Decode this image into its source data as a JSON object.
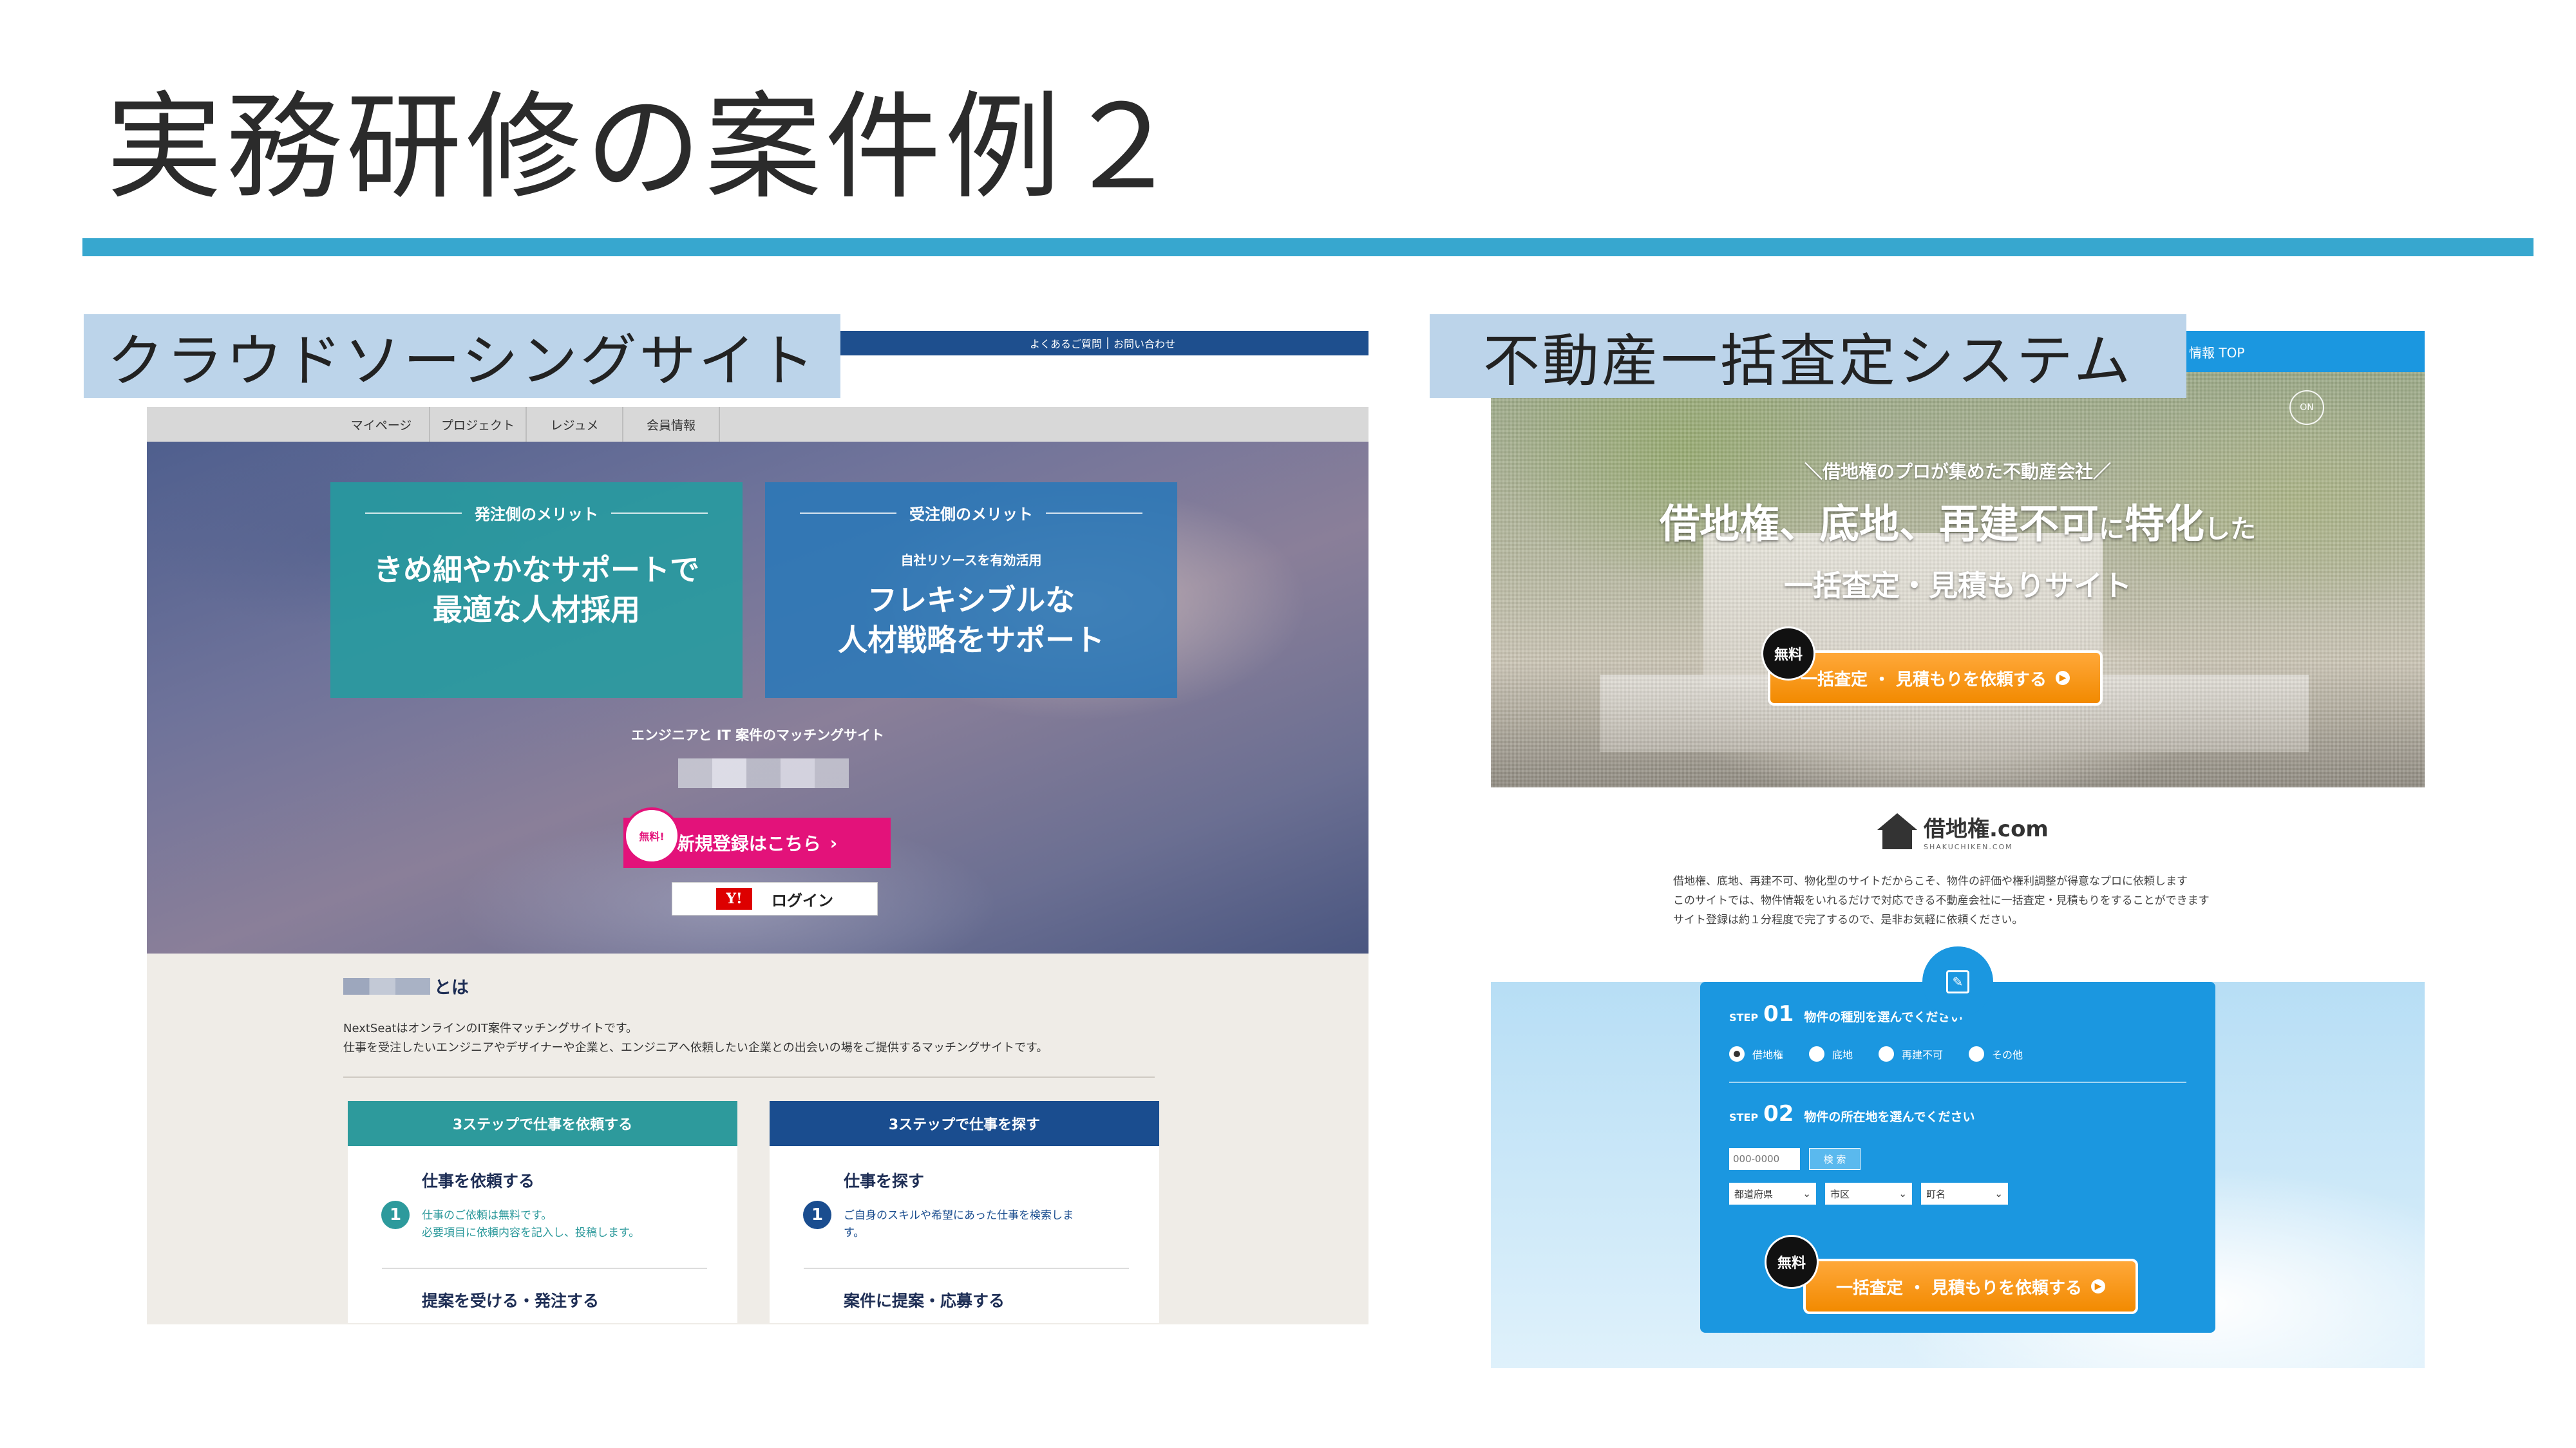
{
  "slide": {
    "title": "実務研修の案件例２",
    "left_label": "クラウドソーシングサイト",
    "right_label": "不動産一括査定システム"
  },
  "crowdsourcing": {
    "topbar": {
      "faq": "よくあるご質問",
      "contact": "お問い合わせ"
    },
    "nav": [
      "マイページ",
      "プロジェクト",
      "レジュメ",
      "会員情報"
    ],
    "card_client": {
      "head": "発注側のメリット",
      "main": "きめ細やかなサポートで\n最適な人材採用"
    },
    "card_worker": {
      "head": "受注側のメリット",
      "sub": "自社リソースを有効活用",
      "main": "フレキシブルな\n人材戦略をサポート"
    },
    "tagline": "エンジニアと IT 案件のマッチングサイト",
    "free_badge": "無料!",
    "signup": "新規登録はこちら",
    "signup_arrow": "›",
    "yahoo": "Y!",
    "login": "ログイン",
    "about_suffix": "とは",
    "about_text": "NextSeatはオンラインのIT案件マッチングサイトです。\n仕事を受注したいエンジニアやデザイナーや企業と、エンジニアへ依頼したい企業との出会いの場をご提供するマッチングサイトです。",
    "steps_client": {
      "head": "3ステップで仕事を依頼する",
      "num": "1",
      "title": "仕事を依頼する",
      "desc": "仕事のご依頼は無料です。\n必要項目に依頼内容を記入し、投稿します。",
      "next": "提案を受ける・発注する"
    },
    "steps_worker": {
      "head": "3ステップで仕事を探す",
      "num": "1",
      "title": "仕事を探す",
      "desc": "ご自身のスキルや希望にあった仕事を検索しま\nす。",
      "next": "案件に提案・応募する"
    }
  },
  "realestate": {
    "topbar": "情報 TOP",
    "sound": "ON",
    "kicker": "＼借地権のプロが集めた不動産会社／",
    "h1_main": "借地権、底地、再建不可",
    "h1_ni": "に",
    "h1_tokka": "特化",
    "h1_shita": "した",
    "h2": "一括査定・見積もりサイト",
    "free": "無料",
    "cta": "一括査定 ・ 見積もりを依頼する",
    "cta_arrow": "▶",
    "brand_name": "借地権.com",
    "brand_sub": "SHAKUCHIKEN.COM",
    "intro": "借地権、底地、再建不可、物化型のサイトだからこそ、物件の評価や権利調整が得意なプロに依頼します\nこのサイトでは、物件情報をいれるだけで対応できる不動産会社に一括査定・見積もりをすることができます\nサイト登録は約１分程度で完了するので、是非お気軽に依頼ください。",
    "form_icon": "✎",
    "step1": {
      "label": "STEP",
      "num": "01",
      "prompt": "物件の種別を選んでください"
    },
    "types": [
      "借地権",
      "底地",
      "再建不可",
      "その他"
    ],
    "step2": {
      "label": "STEP",
      "num": "02",
      "prompt": "物件の所在地を選んでください"
    },
    "zip_placeholder": "000-0000",
    "search": "検 索",
    "selects": [
      "都道府県",
      "市区",
      "町名"
    ],
    "select_arrow": "⌄"
  }
}
